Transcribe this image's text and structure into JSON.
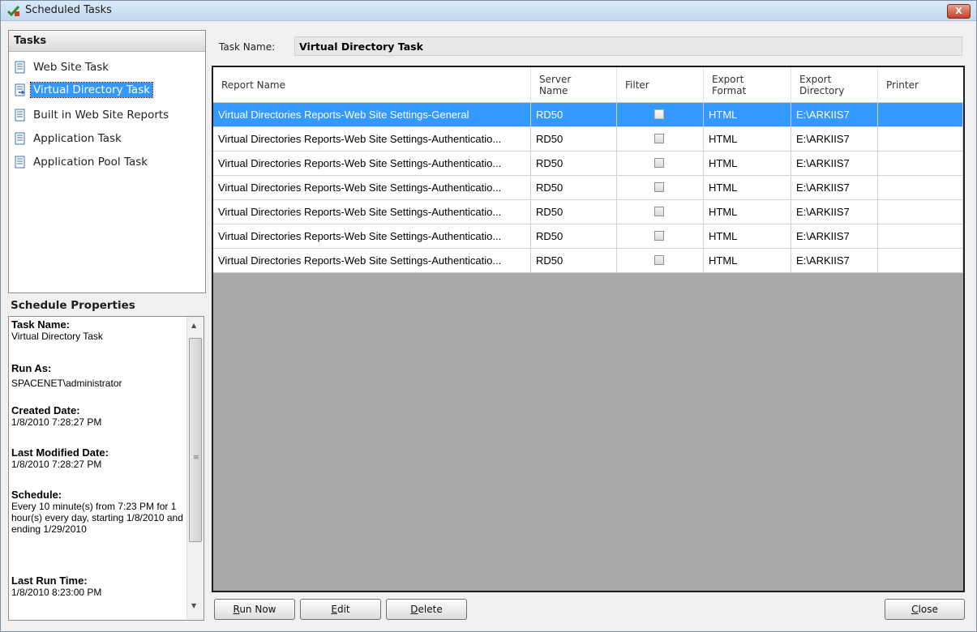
{
  "window": {
    "title": "Scheduled Tasks",
    "close_glyph": "X"
  },
  "tasks_panel": {
    "header": "Tasks",
    "items": [
      {
        "label": "Web Site Task",
        "selected": false
      },
      {
        "label": "Virtual Directory Task",
        "selected": true
      },
      {
        "label": "Built in Web Site Reports",
        "selected": false
      },
      {
        "label": "Application Task",
        "selected": false
      },
      {
        "label": "Application Pool Task",
        "selected": false
      }
    ]
  },
  "schedule_properties": {
    "title": "Schedule Properties",
    "fields": [
      {
        "key": "Task Name:",
        "value": "Virtual Directory Task"
      },
      {
        "key": "Run As:",
        "value": "SPACENET\\administrator"
      },
      {
        "key": "Created Date:",
        "value": "1/8/2010 7:28:27 PM"
      },
      {
        "key": "Last Modified Date:",
        "value": "1/8/2010 7:28:27 PM"
      },
      {
        "key": "Schedule:",
        "value": "Every 10 minute(s) from 7:23 PM for 1 hour(s) every day, starting 1/8/2010 and ending 1/29/2010"
      },
      {
        "key": "Last Run Time:",
        "value": "1/8/2010 8:23:00 PM"
      }
    ]
  },
  "task_name": {
    "label": "Task Name:",
    "value": "Virtual Directory Task"
  },
  "grid": {
    "columns": [
      "Report Name",
      "Server Name",
      "Filter",
      "Export Format",
      "Export Directory",
      "Printer"
    ],
    "rows": [
      {
        "report": "Virtual Directories Reports-Web Site Settings-General",
        "server": "RD50",
        "filter": false,
        "format": "HTML",
        "directory": "E:\\ARKIIS7",
        "printer": "",
        "selected": true
      },
      {
        "report": "Virtual Directories Reports-Web Site Settings-Authenticatio...",
        "server": "RD50",
        "filter": false,
        "format": "HTML",
        "directory": "E:\\ARKIIS7",
        "printer": "",
        "selected": false
      },
      {
        "report": "Virtual Directories Reports-Web Site Settings-Authenticatio...",
        "server": "RD50",
        "filter": false,
        "format": "HTML",
        "directory": "E:\\ARKIIS7",
        "printer": "",
        "selected": false
      },
      {
        "report": "Virtual Directories Reports-Web Site Settings-Authenticatio...",
        "server": "RD50",
        "filter": false,
        "format": "HTML",
        "directory": "E:\\ARKIIS7",
        "printer": "",
        "selected": false
      },
      {
        "report": "Virtual Directories Reports-Web Site Settings-Authenticatio...",
        "server": "RD50",
        "filter": false,
        "format": "HTML",
        "directory": "E:\\ARKIIS7",
        "printer": "",
        "selected": false
      },
      {
        "report": "Virtual Directories Reports-Web Site Settings-Authenticatio...",
        "server": "RD50",
        "filter": false,
        "format": "HTML",
        "directory": "E:\\ARKIIS7",
        "printer": "",
        "selected": false
      },
      {
        "report": "Virtual Directories Reports-Web Site Settings-Authenticatio...",
        "server": "RD50",
        "filter": false,
        "format": "HTML",
        "directory": "E:\\ARKIIS7",
        "printer": "",
        "selected": false
      }
    ]
  },
  "buttons": {
    "run_now": {
      "mnemonic": "R",
      "rest": "un Now"
    },
    "edit": {
      "mnemonic": "E",
      "rest": "dit"
    },
    "delete": {
      "mnemonic": "D",
      "rest": "elete"
    },
    "close": {
      "mnemonic": "C",
      "rest": "lose"
    }
  },
  "colors": {
    "selection": "#3399ff",
    "grid_background": "#a8a8a8",
    "titlebar": "#c3d8ee"
  },
  "icons": {
    "window": "scheduled-tasks-icon",
    "task": "task-list-icon",
    "selected_task": "task-run-icon"
  }
}
